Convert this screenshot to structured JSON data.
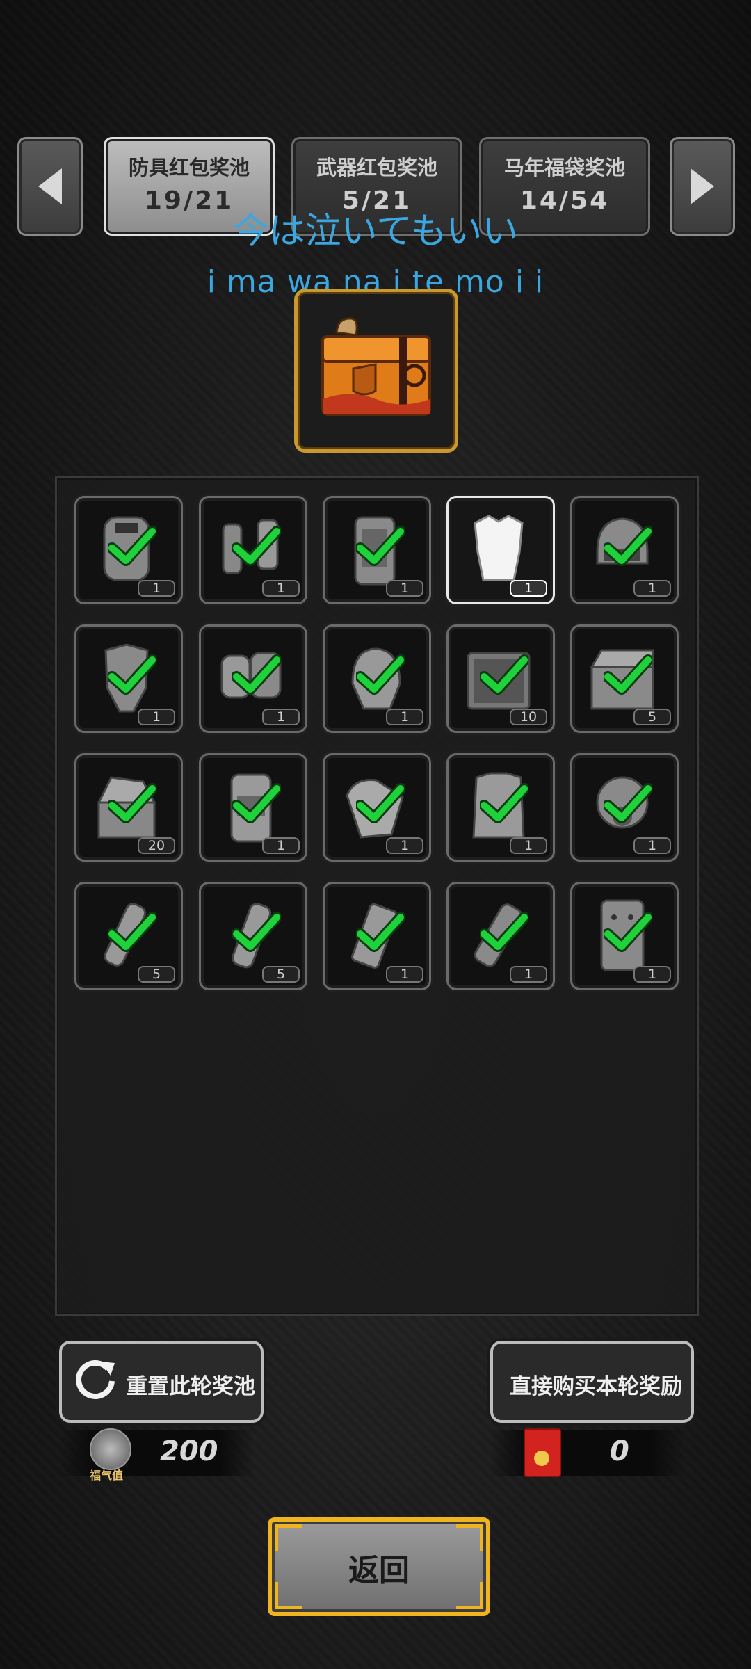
{
  "tabs": [
    {
      "title": "防具红包奖池",
      "progress": "19/21",
      "active": true
    },
    {
      "title": "武器红包奖池",
      "progress": "5/21",
      "active": false
    },
    {
      "title": "马年福袋奖池",
      "progress": "14/54",
      "active": false
    }
  ],
  "lyrics": {
    "line1": "今は泣いてもいい",
    "line2": "i ma wa na i te mo i i"
  },
  "grid": {
    "items": [
      {
        "icon": "riot-shield-icon",
        "count": "1",
        "collected": true
      },
      {
        "icon": "arm-guard-icon",
        "count": "1",
        "collected": true
      },
      {
        "icon": "armor-plate-icon",
        "count": "1",
        "collected": true
      },
      {
        "icon": "body-armor-icon",
        "count": "1",
        "collected": false,
        "selected": true
      },
      {
        "icon": "tactical-helmet-icon",
        "count": "1",
        "collected": true
      },
      {
        "icon": "armor-suit-icon",
        "count": "1",
        "collected": true
      },
      {
        "icon": "gloves-icon",
        "count": "1",
        "collected": true
      },
      {
        "icon": "helmet-icon",
        "count": "1",
        "collected": true
      },
      {
        "icon": "toolkit-icon",
        "count": "10",
        "collected": true
      },
      {
        "icon": "tool-box-icon",
        "count": "5",
        "collected": true
      },
      {
        "icon": "repair-kit-icon",
        "count": "20",
        "collected": true
      },
      {
        "icon": "backpack-icon",
        "count": "1",
        "collected": true
      },
      {
        "icon": "glove-icon",
        "count": "1",
        "collected": true
      },
      {
        "icon": "tactical-vest-icon",
        "count": "1",
        "collected": true
      },
      {
        "icon": "gas-mask-icon",
        "count": "1",
        "collected": true
      },
      {
        "icon": "grenade-icon",
        "count": "5",
        "collected": true
      },
      {
        "icon": "frag-grenade-icon",
        "count": "5",
        "collected": true
      },
      {
        "icon": "dynamite-icon",
        "count": "1",
        "collected": true
      },
      {
        "icon": "smoke-grenade-icon",
        "count": "1",
        "collected": true
      },
      {
        "icon": "ballistic-shield-icon",
        "count": "1",
        "collected": true
      }
    ]
  },
  "buttons": {
    "reset": "重置此轮奖池",
    "buy": "直接购买本轮奖励",
    "back": "返回"
  },
  "stats": {
    "luck_label": "福气值",
    "luck_value": "200",
    "envelope_value": "0"
  },
  "colors": {
    "check": "#1fd13a",
    "gold": "#f0b51e",
    "lyric": "#3aa7e0"
  }
}
